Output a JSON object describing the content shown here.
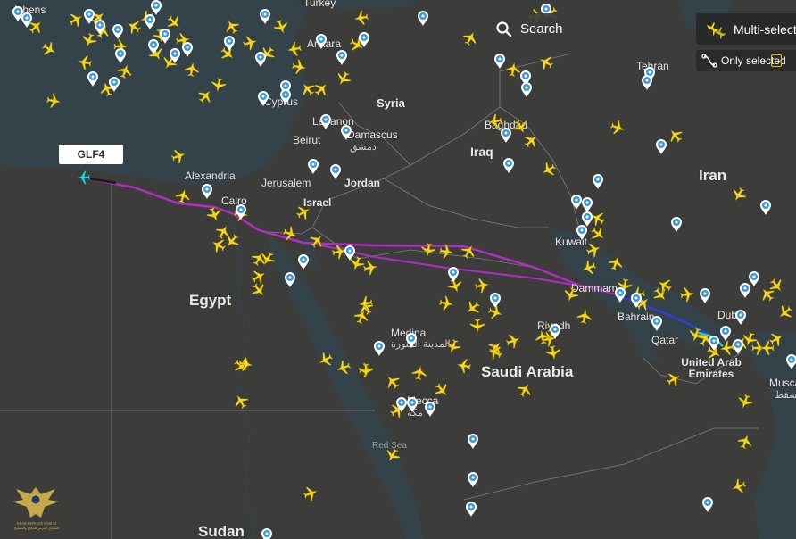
{
  "search": {
    "label": "Search"
  },
  "multi_select": {
    "label": "Multi-select"
  },
  "only_selected": {
    "label": "Only selected",
    "toggle_state": "off"
  },
  "selected_flight": {
    "callsign": "GLF4"
  },
  "countries": [
    {
      "name": "Egypt"
    },
    {
      "name": "Saudi Arabia"
    },
    {
      "name": "Iraq"
    },
    {
      "name": "Iran"
    },
    {
      "name": "Syria"
    },
    {
      "name": "Jordan"
    },
    {
      "name": "Israel"
    },
    {
      "name": "Sudan"
    },
    {
      "name": "United Arab Emirates"
    },
    {
      "name": "Turkey"
    }
  ],
  "cities": [
    {
      "name": "Athens"
    },
    {
      "name": "Alexandria"
    },
    {
      "name": "Cairo"
    },
    {
      "name": "Beirut"
    },
    {
      "name": "Damascus",
      "arabic": "دمشق"
    },
    {
      "name": "Jerusalem"
    },
    {
      "name": "Lebanon"
    },
    {
      "name": "Cyprus"
    },
    {
      "name": "Ankara"
    },
    {
      "name": "Baghdad"
    },
    {
      "name": "Tehran"
    },
    {
      "name": "Kuwait"
    },
    {
      "name": "Dammam"
    },
    {
      "name": "Bahrain"
    },
    {
      "name": "Qatar"
    },
    {
      "name": "Riyadh"
    },
    {
      "name": "Medina",
      "arabic": "المدينة المنورة"
    },
    {
      "name": "Mecca",
      "arabic": "مكة"
    },
    {
      "name": "Dubai"
    },
    {
      "name": "Muscat",
      "arabic": "مسقط"
    }
  ],
  "seas": [
    {
      "name": "Red Sea"
    }
  ],
  "watermark": {
    "text": "ARAB DEFENSE FORUM",
    "arabic": "المنتدى العربي للدفاع والتسليح"
  },
  "colors": {
    "land": "#3c3d3a",
    "sea": "#34424a",
    "aircraft": "#f3d51b",
    "pin": "#3a9ad9",
    "route_primary": "#b02cc4",
    "route_secondary": "#2c3fd4",
    "route_start": "#1fd0d0"
  },
  "icons": [
    "search-icon",
    "multi-select-icon",
    "only-selected-icon",
    "aircraft-icon",
    "airport-pin-icon"
  ]
}
